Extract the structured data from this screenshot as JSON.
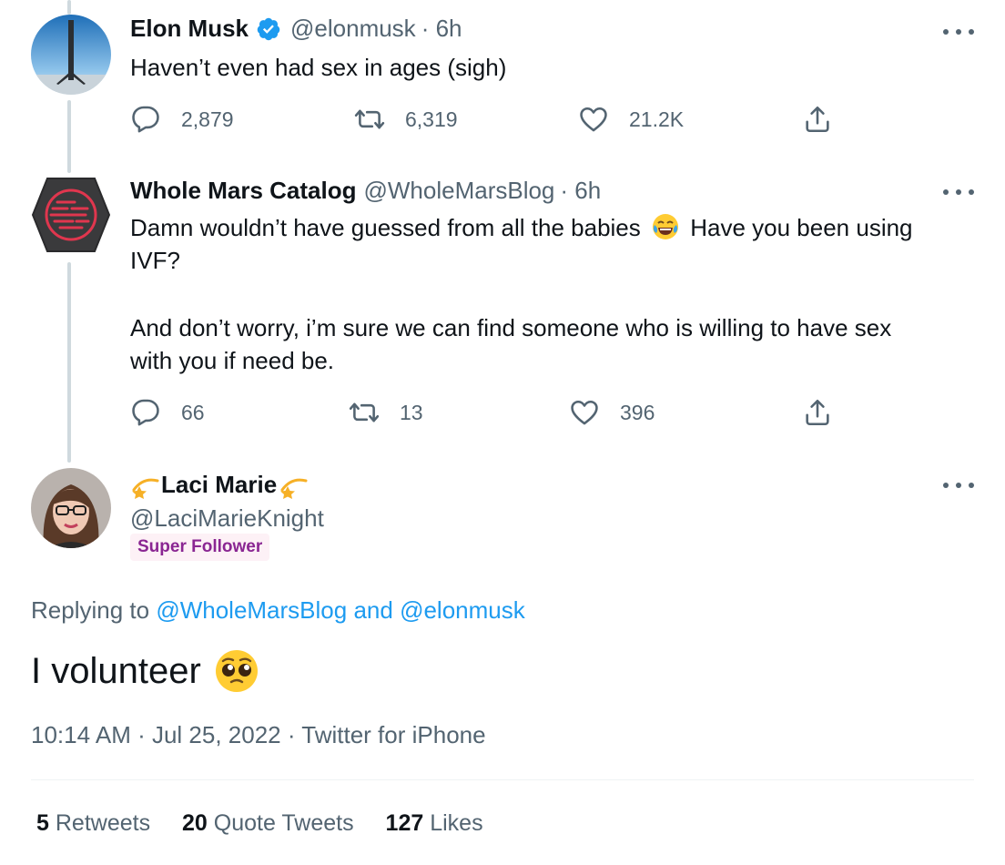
{
  "tweets": [
    {
      "name": "Elon Musk",
      "handle": "@elonmusk",
      "time": "· 6h",
      "text": "Haven’t even had sex in ages (sigh)",
      "reply_count": "2,879",
      "retweet_count": "6,319",
      "like_count": "21.2K",
      "verified": true
    },
    {
      "name": "Whole Mars Catalog",
      "handle": "@WholeMarsBlog",
      "time": "· 6h",
      "text_line1": "Damn wouldn’t have guessed from all the babies",
      "text_line1b": "Have you been using",
      "text_line2": "IVF?",
      "text_para2_line1": "And don’t worry, i’m sure we can find someone who is willing to have sex",
      "text_para2_line2": "with you if need be.",
      "reply_count": "66",
      "retweet_count": "13",
      "like_count": "396"
    }
  ],
  "main_tweet": {
    "name": "Laci Marie",
    "handle": "@LaciMarieKnight",
    "badge": "Super Follower",
    "replying_to_prefix": "Replying to",
    "replying_to_user1": "@WholeMarsBlog",
    "replying_to_and": "and",
    "replying_to_user2": "@elonmusk",
    "text": "I volunteer",
    "timestamp": "10:14 AM · Jul 25, 2022 · Twitter for iPhone",
    "stats": {
      "retweets_count": "5",
      "retweets_label": "Retweets",
      "quotes_count": "20",
      "quotes_label": "Quote Tweets",
      "likes_count": "127",
      "likes_label": "Likes"
    }
  },
  "colors": {
    "link": "#1d9bf0",
    "secondary_text": "#536471",
    "verified": "#1d9bf0",
    "badge_text": "#8a2692"
  }
}
